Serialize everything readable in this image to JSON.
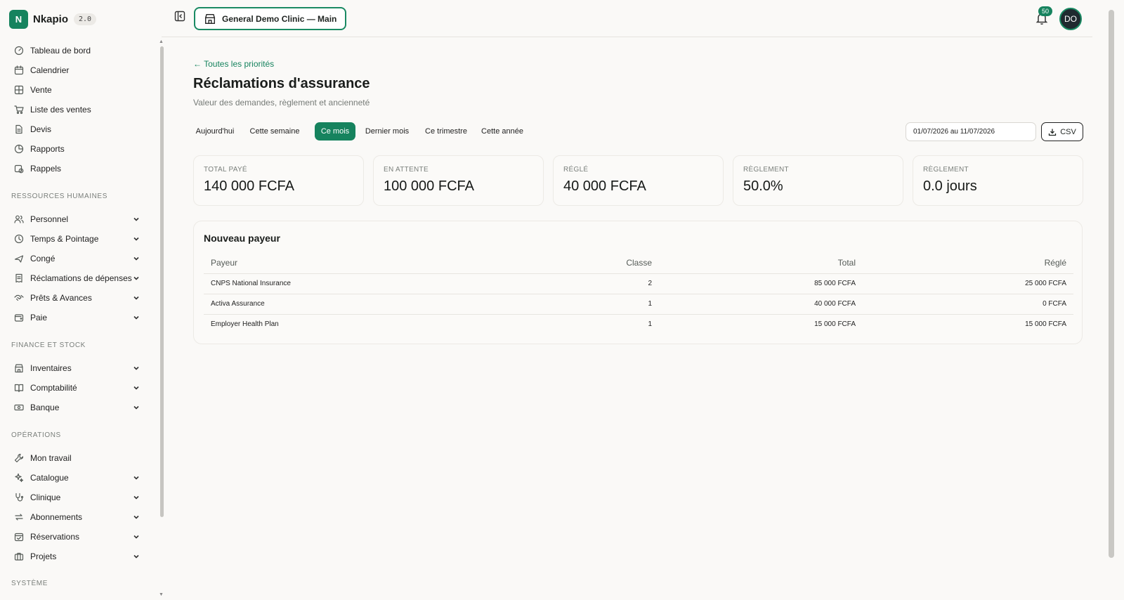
{
  "app": {
    "name": "Nkapio",
    "version": "2.0"
  },
  "sidebar": {
    "top_items": [
      {
        "label": "Tableau de bord",
        "icon": "gauge-icon"
      },
      {
        "label": "Calendrier",
        "icon": "calendar-icon"
      },
      {
        "label": "Vente",
        "icon": "grid-icon"
      },
      {
        "label": "Liste des ventes",
        "icon": "cart-icon"
      },
      {
        "label": "Devis",
        "icon": "document-icon"
      },
      {
        "label": "Rapports",
        "icon": "pie-chart-icon"
      },
      {
        "label": "Rappels",
        "icon": "calendar-clock-icon"
      }
    ],
    "sections": [
      {
        "title": "RESSOURCES HUMAINES",
        "items": [
          {
            "label": "Personnel",
            "icon": "users-icon"
          },
          {
            "label": "Temps & Pointage",
            "icon": "clock-icon"
          },
          {
            "label": "Congé",
            "icon": "plane-icon"
          },
          {
            "label": "Réclamations de dépenses",
            "icon": "receipt-icon"
          },
          {
            "label": "Prêts & Avances",
            "icon": "handshake-icon"
          },
          {
            "label": "Paie",
            "icon": "wallet-icon"
          }
        ]
      },
      {
        "title": "FINANCE ET STOCK",
        "items": [
          {
            "label": "Inventaires",
            "icon": "store-icon"
          },
          {
            "label": "Comptabilité",
            "icon": "book-icon"
          },
          {
            "label": "Banque",
            "icon": "banknote-icon"
          }
        ]
      },
      {
        "title": "OPÉRATIONS",
        "items": [
          {
            "label": "Mon travail",
            "icon": "wrench-icon"
          },
          {
            "label": "Catalogue",
            "icon": "sparkles-icon"
          },
          {
            "label": "Clinique",
            "icon": "stethoscope-icon"
          },
          {
            "label": "Abonnements",
            "icon": "repeat-icon"
          },
          {
            "label": "Réservations",
            "icon": "calendar-check-icon"
          },
          {
            "label": "Projets",
            "icon": "briefcase-icon"
          }
        ]
      },
      {
        "title": "SYSTÈME",
        "items": []
      }
    ]
  },
  "header": {
    "clinic_label": "General Demo Clinic — Main",
    "notifications_count": "50",
    "avatar_initials": "DO"
  },
  "page": {
    "back_link": "← Toutes les priorités",
    "title": "Réclamations d'assurance",
    "subtitle": "Valeur des demandes, règlement et ancienneté",
    "periods": [
      "Aujourd'hui",
      "Cette semaine",
      "Ce mois",
      "Dernier mois",
      "Ce trimestre",
      "Cette année"
    ],
    "active_period": "Ce mois",
    "date_range": "01/07/2026 au 11/07/2026",
    "csv_label": "CSV"
  },
  "stats": [
    {
      "label": "TOTAL PAYÉ",
      "value": "140 000 FCFA"
    },
    {
      "label": "EN ATTENTE",
      "value": "100 000 FCFA"
    },
    {
      "label": "RÉGLÉ",
      "value": "40 000 FCFA"
    },
    {
      "label": "RÈGLEMENT",
      "value": "50.0%"
    },
    {
      "label": "RÈGLEMENT",
      "value": "0.0 jours"
    }
  ],
  "payer_table": {
    "title": "Nouveau payeur",
    "columns": [
      "Payeur",
      "Classe",
      "Total",
      "Réglé"
    ],
    "rows": [
      [
        "CNPS National Insurance",
        "2",
        "85 000 FCFA",
        "25 000 FCFA"
      ],
      [
        "Activa Assurance",
        "1",
        "40 000 FCFA",
        "0 FCFA"
      ],
      [
        "Employer Health Plan",
        "1",
        "15 000 FCFA",
        "15 000 FCFA"
      ]
    ]
  },
  "colors": {
    "accent": "#16835e",
    "background": "#faf9f7"
  }
}
